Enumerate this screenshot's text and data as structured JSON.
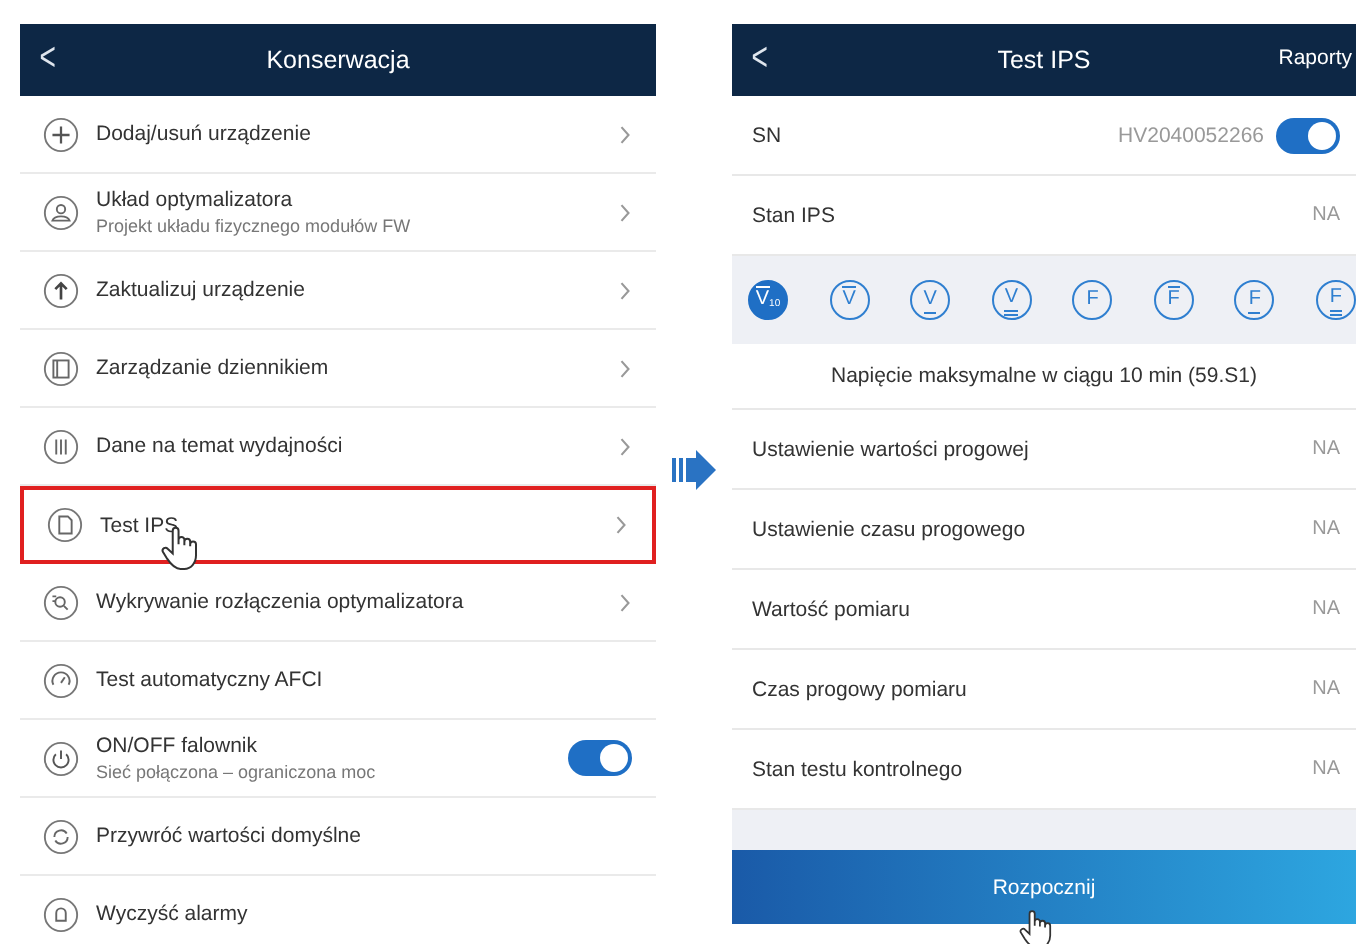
{
  "left_screen": {
    "back": "<",
    "title": "Konserwacja",
    "items": [
      {
        "kind": "link",
        "label": "Dodaj/usuń urządzenie",
        "highlighted": false
      },
      {
        "kind": "link",
        "label": "Układ optymalizatora",
        "sublabel": "Projekt układu fizycznego modułów FW",
        "highlighted": false
      },
      {
        "kind": "link",
        "label": "Zaktualizuj urządzenie",
        "highlighted": false
      },
      {
        "kind": "link",
        "label": "Zarządzanie dziennikiem",
        "highlighted": false
      },
      {
        "kind": "link",
        "label": "Dane na temat wydajności",
        "highlighted": false
      },
      {
        "kind": "link",
        "label": "Test IPS",
        "highlighted": true
      },
      {
        "kind": "link",
        "label": "Wykrywanie rozłączenia optymalizatora",
        "highlighted": false
      },
      {
        "kind": "plain",
        "label": "Test automatyczny AFCI",
        "highlighted": false
      },
      {
        "kind": "toggle",
        "label": "ON/OFF falownik",
        "sublabel": "Sieć połączona – ograniczona moc",
        "on": true,
        "highlighted": false
      },
      {
        "kind": "plain",
        "label": "Przywróć wartości domyślne",
        "highlighted": false
      },
      {
        "kind": "plain",
        "label": "Wyczyść alarmy",
        "highlighted": false
      }
    ]
  },
  "right_screen": {
    "back": "<",
    "title": "Test IPS",
    "action": "Raporty",
    "sn": {
      "label": "SN",
      "value": "HV2040052266",
      "on": true
    },
    "status": {
      "label": "Stan IPS",
      "value": "NA"
    },
    "test_tabs": [
      {
        "letter": "V",
        "sub": "10",
        "kind": "over",
        "selected": true
      },
      {
        "letter": "V",
        "kind": "over",
        "selected": false
      },
      {
        "letter": "V",
        "kind": "under",
        "selected": false
      },
      {
        "letter": "V",
        "kind": "double",
        "selected": false
      },
      {
        "letter": "F",
        "kind": "plain",
        "selected": false
      },
      {
        "letter": "F",
        "kind": "over",
        "selected": false
      },
      {
        "letter": "F",
        "kind": "under",
        "selected": false
      },
      {
        "letter": "F",
        "kind": "double",
        "selected": false
      }
    ],
    "caption": "Napięcie maksymalne w ciągu 10 min (59.S1)",
    "rows": [
      {
        "label": "Ustawienie wartości progowej",
        "value": "NA"
      },
      {
        "label": "Ustawienie czasu progowego",
        "value": "NA"
      },
      {
        "label": "Wartość pomiaru",
        "value": "NA"
      },
      {
        "label": "Czas progowy pomiaru",
        "value": "NA"
      },
      {
        "label": "Stan testu kontrolnego",
        "value": "NA"
      }
    ],
    "button": "Rozpocznij"
  }
}
